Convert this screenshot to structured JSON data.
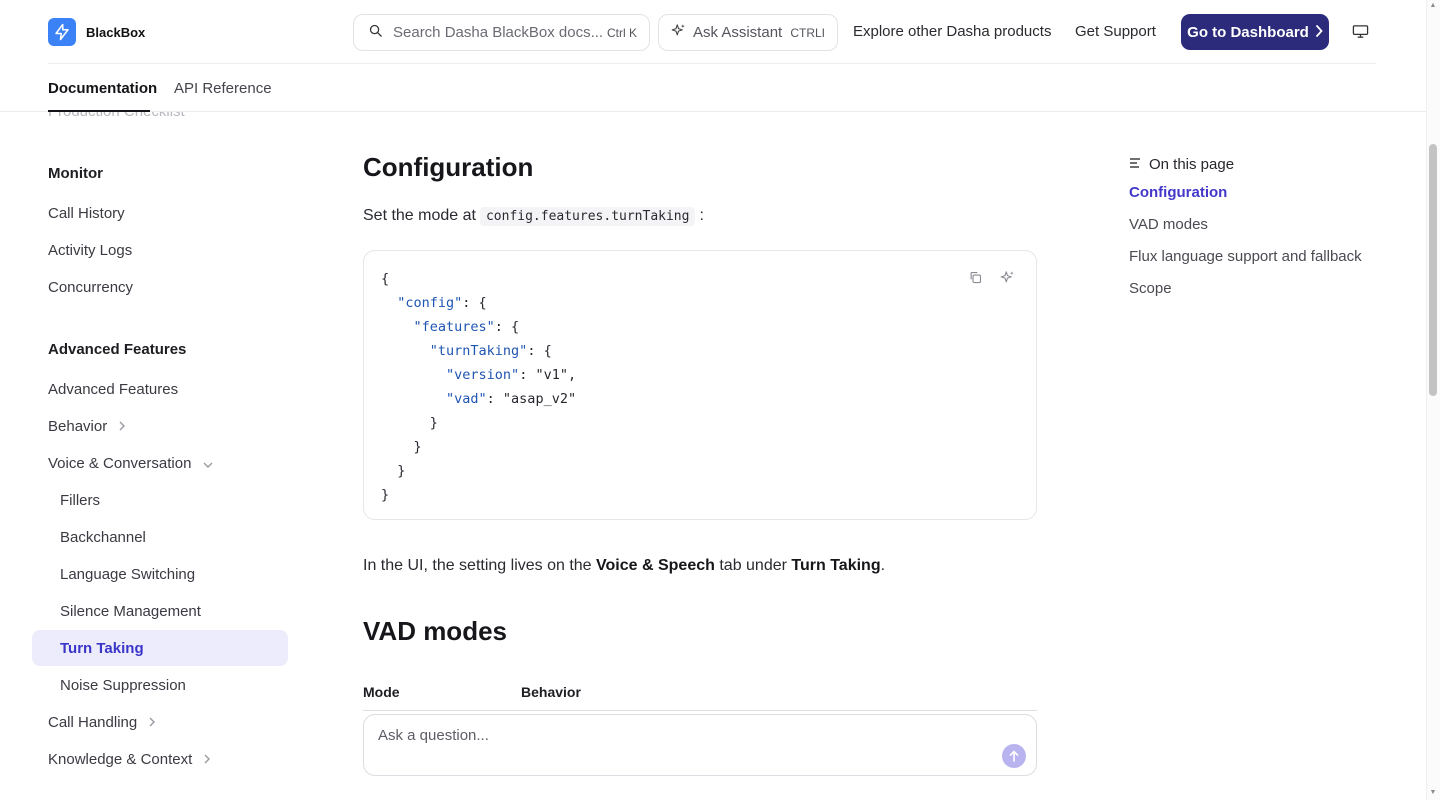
{
  "header": {
    "brand": "BlackBox",
    "search_placeholder": "Search Dasha BlackBox docs...",
    "search_shortcut": "Ctrl K",
    "assistant_label": "Ask Assistant",
    "assistant_shortcut": "CTRLI",
    "explore_link": "Explore other Dasha products",
    "support_link": "Get Support",
    "dashboard_button": "Go to Dashboard",
    "accent_color": "#2b2a7b"
  },
  "tabs": [
    {
      "label": "Documentation",
      "active": true
    },
    {
      "label": "API Reference",
      "active": false
    }
  ],
  "sidebar": {
    "cut_item": "Production Checklist",
    "sections": [
      {
        "title": "Monitor",
        "items": [
          "Call History",
          "Activity Logs",
          "Concurrency"
        ]
      },
      {
        "title": "Advanced Features",
        "items": [
          "Advanced Features",
          "Behavior",
          "Voice & Conversation",
          "Fillers",
          "Backchannel",
          "Language Switching",
          "Silence Management",
          "Turn Taking",
          "Noise Suppression",
          "Call Handling",
          "Knowledge & Context"
        ]
      }
    ],
    "active_item": "Turn Taking",
    "active_color": "#3b36c8"
  },
  "main": {
    "configuration": {
      "heading": "Configuration",
      "intro_before": "Set the mode at",
      "intro_code": "config.features.turnTaking",
      "intro_after": ":",
      "code_lines": [
        "{",
        "  \"config\": {",
        "    \"features\": {",
        "      \"turnTaking\": {",
        "        \"version\": \"v1\",",
        "        \"vad\": \"asap_v2\"",
        "      }",
        "    }",
        "  }",
        "}"
      ],
      "ui_note_pre": "In the UI, the setting lives on the",
      "ui_note_b1": "Voice & Speech",
      "ui_note_mid": "tab under",
      "ui_note_b2": "Turn Taking",
      "ui_note_end": "."
    },
    "vad_modes": {
      "heading": "VAD modes",
      "columns": [
        "Mode",
        "Behavior"
      ]
    },
    "ask_placeholder": "Ask a question..."
  },
  "toc": {
    "title": "On this page",
    "items": [
      "Configuration",
      "VAD modes",
      "Flux language support and fallback",
      "Scope"
    ],
    "active_index": 0,
    "active_color": "#4338ca"
  }
}
